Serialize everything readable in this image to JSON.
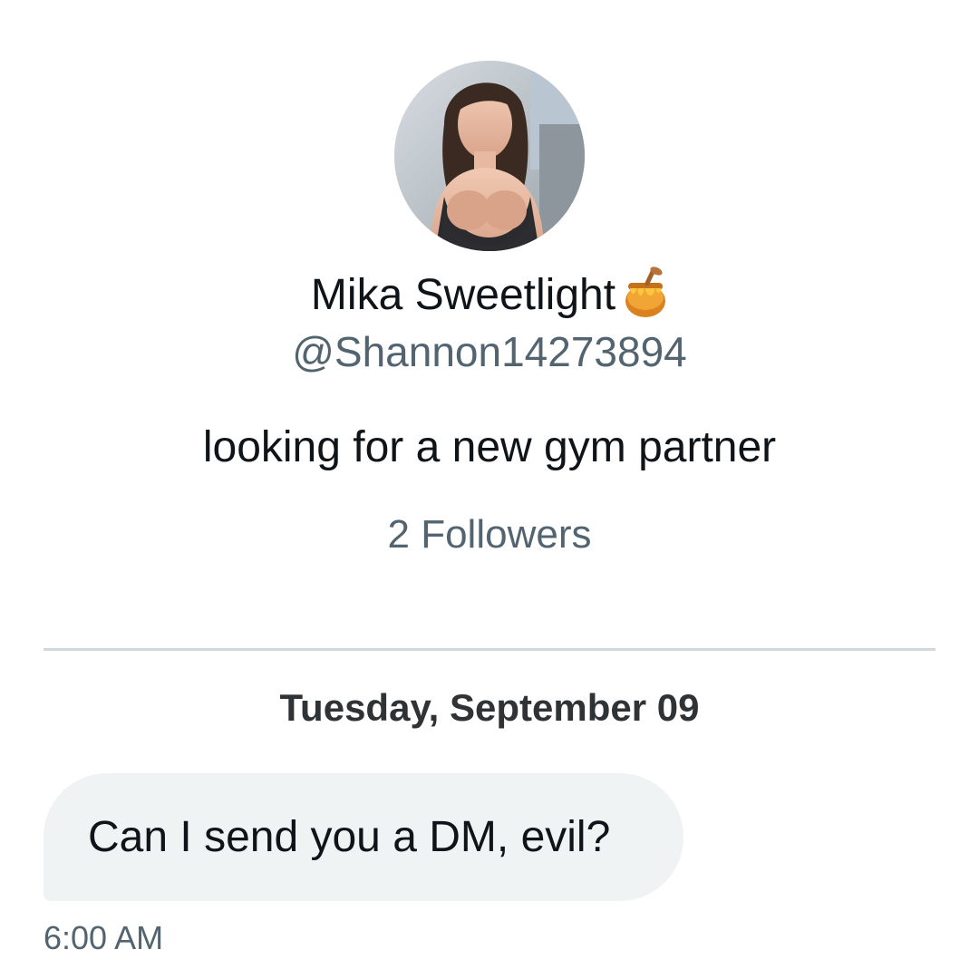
{
  "profile": {
    "display_name": "Mika Sweetlight",
    "name_emoji_icon": "honey-pot-icon",
    "handle": "@Shannon14273894",
    "bio": "looking for a new gym partner",
    "followers_text": "2 Followers"
  },
  "conversation": {
    "date_separator": "Tuesday, September 09",
    "messages": [
      {
        "text": "Can I send you a DM, evil?",
        "time": "6:00 AM"
      }
    ]
  },
  "colors": {
    "primary_text": "#0f1419",
    "secondary_text": "#536471",
    "divider": "#cfd9de",
    "bubble_background": "#eff3f4",
    "background": "#ffffff"
  }
}
